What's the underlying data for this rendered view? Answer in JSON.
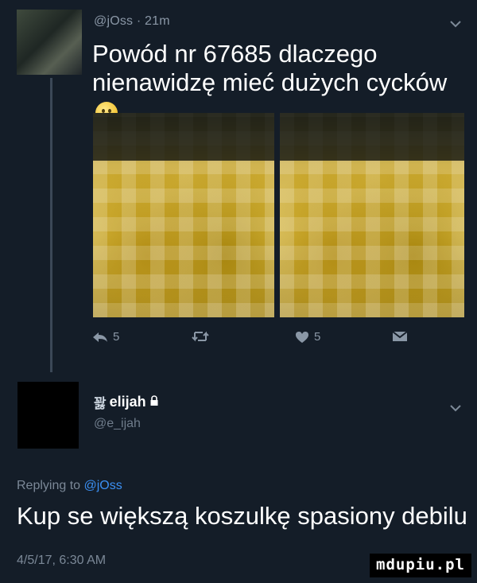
{
  "tweet": {
    "handle_time": "@jOss · 21m",
    "text": "Powód nr 67685 dlaczego nienawidzę mieć dużych cycków",
    "actions": {
      "reply_count": "5",
      "like_count": "5"
    }
  },
  "reply": {
    "display_name": "elijah",
    "name_prefix": "꽗",
    "handle": "@e_ijah",
    "replying_label": "Replying to",
    "replying_mention": "@jOss",
    "text": "Kup se większą koszulkę spasiony debilu",
    "timestamp": "4/5/17, 6:30 AM"
  },
  "watermark": "mdupiu.pl",
  "colors": {
    "background": "#141d28",
    "text_primary": "#ffffff",
    "text_secondary": "#8a97a6",
    "mention": "#3b8ff2"
  },
  "icons": [
    "chevron-down-icon",
    "reply-icon",
    "retweet-icon",
    "heart-icon",
    "direct-message-icon",
    "lock-icon",
    "smile-emoji-icon"
  ]
}
